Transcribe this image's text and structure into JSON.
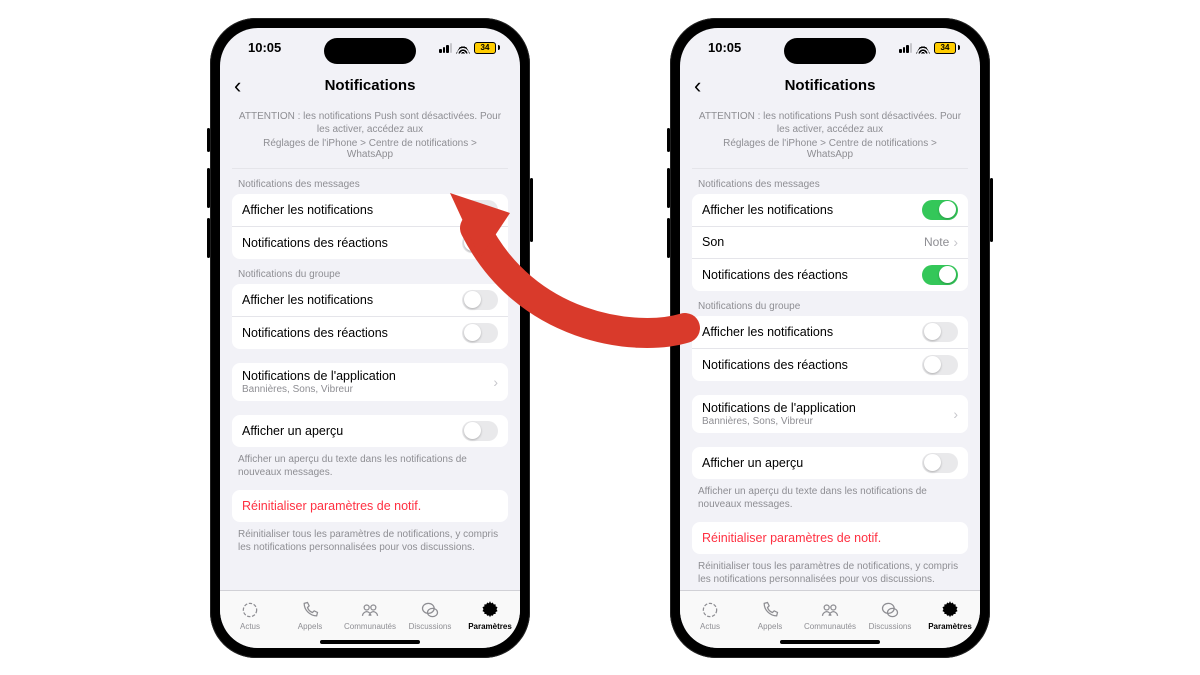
{
  "status": {
    "time": "10:05",
    "battery": "34"
  },
  "nav": {
    "title": "Notifications"
  },
  "warning": {
    "line1": "ATTENTION : les notifications Push sont désactivées. Pour les activer, accédez aux",
    "line2": "Réglages de l'iPhone > Centre de notifications > WhatsApp"
  },
  "headers": {
    "messages": "Notifications des messages",
    "group": "Notifications du groupe"
  },
  "rows": {
    "show_notifs": "Afficher les notifications",
    "reaction_notifs": "Notifications des réactions",
    "sound": "Son",
    "sound_value": "Note",
    "app_notifs_title": "Notifications de l'application",
    "app_notifs_sub": "Bannières, Sons, Vibreur",
    "preview": "Afficher un aperçu",
    "preview_foot": "Afficher un aperçu du texte dans les notifications de nouveaux messages.",
    "reset": "Réinitialiser paramètres de notif.",
    "reset_foot": "Réinitialiser tous les paramètres de notifications, y compris les notifications personnalisées pour vos discussions."
  },
  "tabs": {
    "actus": "Actus",
    "appels": "Appels",
    "communautes": "Communautés",
    "discussions": "Discussions",
    "parametres": "Paramètres"
  }
}
